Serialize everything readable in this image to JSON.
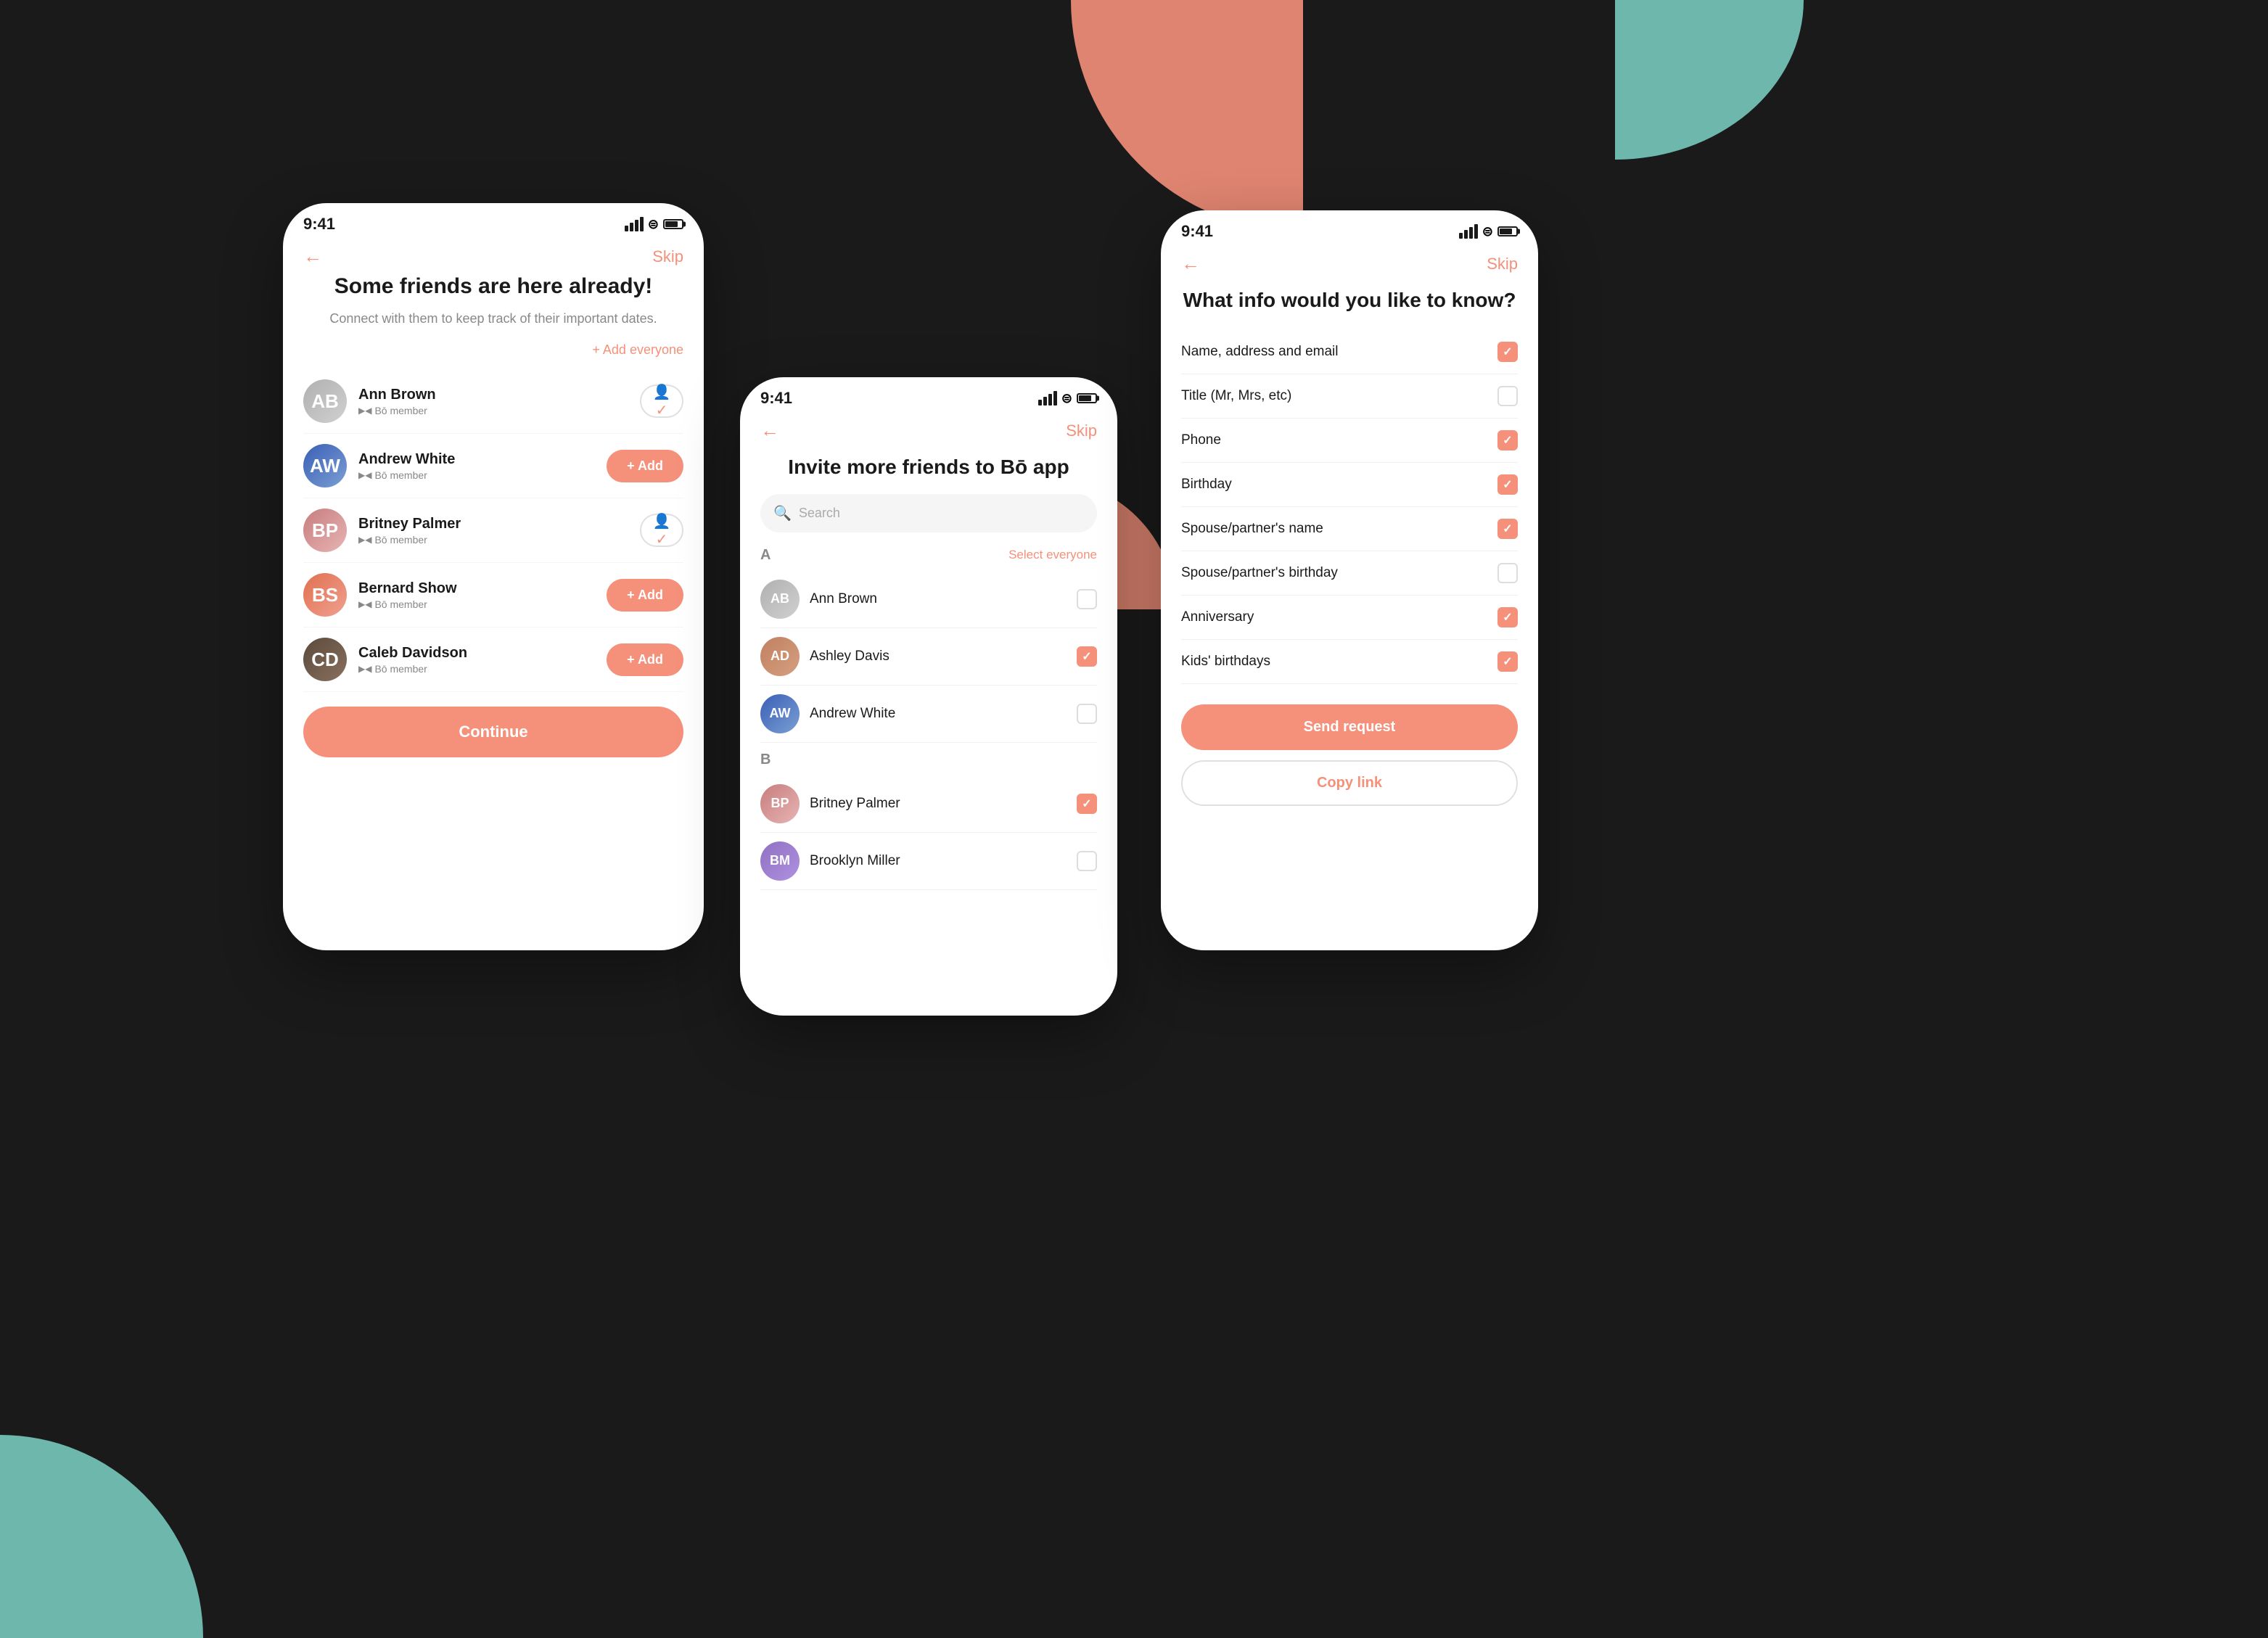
{
  "background": "#1a1a1a",
  "accent": "#F5907A",
  "teal": "#7DD4C8",
  "phone1": {
    "time": "9:41",
    "title": "Some friends are here already!",
    "subtitle": "Connect with them to keep track of their important dates.",
    "add_everyone": "+ Add everyone",
    "friends": [
      {
        "name": "Ann Brown",
        "badge": "Bō member",
        "action": "added"
      },
      {
        "name": "Andrew White",
        "badge": "Bō member",
        "action": "add"
      },
      {
        "name": "Britney Palmer",
        "badge": "Bō member",
        "action": "added"
      },
      {
        "name": "Bernard Show",
        "badge": "Bō member",
        "action": "add"
      },
      {
        "name": "Caleb Davidson",
        "badge": "Bō member",
        "action": "add"
      }
    ],
    "continue_label": "Continue",
    "back_label": "←",
    "skip_label": "Skip"
  },
  "phone2": {
    "time": "9:41",
    "title": "Invite more friends to Bō app",
    "search_placeholder": "Search",
    "back_label": "←",
    "skip_label": "Skip",
    "select_everyone": "Select everyone",
    "sections": [
      {
        "letter": "A",
        "contacts": [
          {
            "name": "Ann Brown",
            "checked": false
          },
          {
            "name": "Ashley Davis",
            "checked": true
          },
          {
            "name": "Andrew White",
            "checked": false
          }
        ]
      },
      {
        "letter": "B",
        "contacts": [
          {
            "name": "Britney Palmer",
            "checked": true
          },
          {
            "name": "Brooklyn Miller",
            "checked": false
          }
        ]
      }
    ]
  },
  "phone3": {
    "time": "9:41",
    "title": "What info would you like to know?",
    "back_label": "←",
    "skip_label": "Skip",
    "info_items": [
      {
        "label": "Name, address and email",
        "checked": true
      },
      {
        "label": "Title (Mr, Mrs, etc)",
        "checked": false
      },
      {
        "label": "Phone",
        "checked": true
      },
      {
        "label": "Birthday",
        "checked": true
      },
      {
        "label": "Spouse/partner's name",
        "checked": true
      },
      {
        "label": "Spouse/partner's birthday",
        "checked": false
      },
      {
        "label": "Anniversary",
        "checked": true
      },
      {
        "label": "Kids' birthdays",
        "checked": true
      }
    ],
    "send_label": "Send request",
    "copy_label": "Copy link"
  }
}
